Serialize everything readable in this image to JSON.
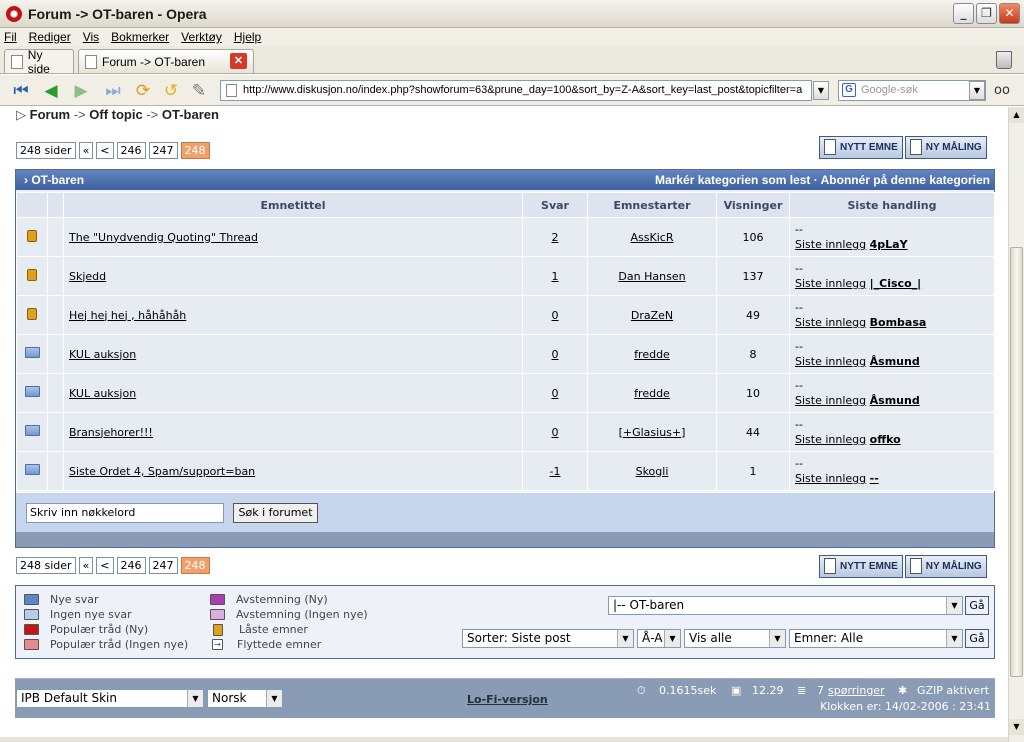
{
  "window": {
    "title": "Forum -> OT-baren - Opera",
    "min": "_",
    "max": "❐",
    "close": "✕"
  },
  "menu": [
    "Fil",
    "Rediger",
    "Vis",
    "Bokmerker",
    "Verktøy",
    "Hjelp"
  ],
  "tabs": [
    {
      "label": "Ny side"
    },
    {
      "label": "Forum -> OT-baren"
    }
  ],
  "address": {
    "url": "http://www.diskusjon.no/index.php?showforum=63&prune_day=100&sort_by=Z-A&sort_key=last_post&topicfilter=a"
  },
  "search": {
    "placeholder": "Google-søk"
  },
  "breadcrumb": {
    "prefix": "▷",
    "items": [
      "Forum",
      "Off topic",
      "OT-baren"
    ],
    "sep": "->"
  },
  "pagination": {
    "pages_label": "248 sider",
    "first": "«",
    "prev": "<",
    "p1": "246",
    "p2": "247",
    "current": "248"
  },
  "actions": {
    "new_topic": "NYTT EMNE",
    "new_poll": "NY MÅLING"
  },
  "forum": {
    "name": "OT-baren",
    "mark_read": "Markér kategorien som lest",
    "dot": "·",
    "subscribe": "Abonnér på denne kategorien",
    "columns": {
      "title": "Emnetittel",
      "replies": "Svar",
      "starter": "Emnestarter",
      "views": "Visninger",
      "last": "Siste handling"
    },
    "rows": [
      {
        "icon": "lock",
        "title": "The \"Unydvendig Quoting\" Thread",
        "replies": "2",
        "starter": "AssKicR",
        "views": "106",
        "last_dash": "--",
        "last_label": "Siste innlegg",
        "last_user": "4pLaY"
      },
      {
        "icon": "lock",
        "title": "Skjedd",
        "replies": "1",
        "starter": "Dan Hansen",
        "views": "137",
        "last_dash": "--",
        "last_label": "Siste innlegg",
        "last_user": "|_Cisco_|"
      },
      {
        "icon": "lock",
        "title": "Hej hej hej , håhåhåh",
        "replies": "0",
        "starter": "DraZeN",
        "views": "49",
        "last_dash": "--",
        "last_label": "Siste innlegg",
        "last_user": "Bombasa"
      },
      {
        "icon": "folder",
        "title": "KUL auksjon",
        "replies": "0",
        "starter": "fredde",
        "views": "8",
        "last_dash": "--",
        "last_label": "Siste innlegg",
        "last_user": "Åsmund"
      },
      {
        "icon": "folder",
        "title": "KUL auksjon",
        "replies": "0",
        "starter": "fredde",
        "views": "10",
        "last_dash": "--",
        "last_label": "Siste innlegg",
        "last_user": "Åsmund"
      },
      {
        "icon": "folder",
        "title": "Bransjehorer!!!",
        "replies": "0",
        "starter": "[+Glasius+]",
        "views": "44",
        "last_dash": "--",
        "last_label": "Siste innlegg",
        "last_user": "offko"
      },
      {
        "icon": "folder",
        "title": "Siste Ordet 4, Spam/support=ban",
        "replies": "-1",
        "starter": "Skogli",
        "views": "1",
        "last_dash": "--",
        "last_label": "Siste innlegg",
        "last_user": "--"
      }
    ],
    "search_value": "Skriv inn nøkkelord",
    "search_button": "Søk i forumet"
  },
  "legend": {
    "new_replies": "Nye svar",
    "no_new": "Ingen nye svar",
    "hot_new": "Populær tråd (Ny)",
    "hot_no_new": "Populær tråd (Ingen nye)",
    "poll_new": "Avstemning (Ny)",
    "poll_no_new": "Avstemning (Ingen nye)",
    "locked": "Låste emner",
    "moved": "Flyttede emner"
  },
  "jump": {
    "forum": "|-- OT-baren",
    "go": "Gå",
    "sort": "Sorter: Siste post",
    "order": "Å-A",
    "show": "Vis alle",
    "topics": "Emner: Alle",
    "go2": "Gå"
  },
  "footer": {
    "skin": "IPB Default Skin",
    "lang": "Norsk",
    "lofi": "Lo-Fi-versjon",
    "time": "0.1615sek",
    "load": "12.29",
    "queries_n": "7",
    "queries": "spørringer",
    "gzip": "GZIP aktivert",
    "clock": "Klokken er: 14/02-2006 : 23:41"
  },
  "colors": {
    "accent": "#3e60a0",
    "current_page": "#f2a06a",
    "lock": "#e2a216"
  }
}
